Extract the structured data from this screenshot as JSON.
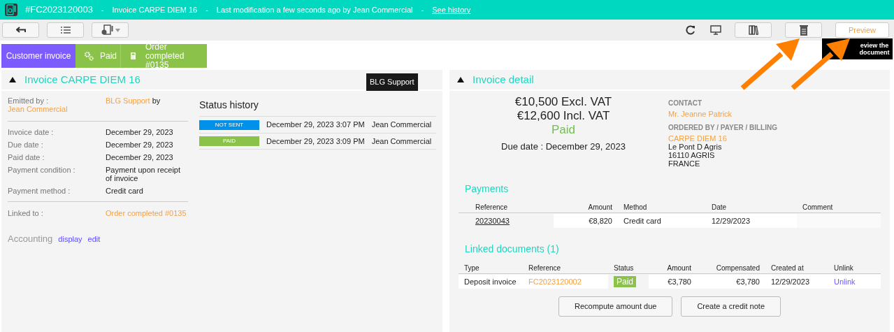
{
  "header": {
    "number": "#FC2023120003",
    "title": "Invoice CARPE DIEM 16",
    "modified": "Last modification a few seconds ago by Jean Commercial",
    "history_link": "See history",
    "separator": "-"
  },
  "toolbar": {
    "preview": "Preview",
    "tooltip": "eview the document"
  },
  "status_steps": [
    {
      "label": "Customer invoice",
      "kind": "type"
    },
    {
      "label": "Paid",
      "kind": "status"
    },
    {
      "label": "Order completed #0135",
      "kind": "order"
    }
  ],
  "invoice_panel": {
    "title": "Invoice CARPE DIEM 16",
    "expanded": true,
    "badge": "BLG Support",
    "emitted_label": "Emitted by :",
    "emitted_company": "BLG Support",
    "emitted_by": "by",
    "emitted_person": "Jean Commercial",
    "fields": [
      {
        "label": "Invoice date :",
        "value": "December 29, 2023"
      },
      {
        "label": "Due date :",
        "value": "December 29, 2023"
      },
      {
        "label": "Paid date :",
        "value": "December 29, 2023"
      },
      {
        "label": "Payment condition :",
        "value": "Payment upon receipt of invoice"
      },
      {
        "label": "Payment method :",
        "value": "Credit card"
      }
    ],
    "linked_label": "Linked to :",
    "linked_value": "Order completed #0135",
    "accounting": "Accounting",
    "accounting_links": [
      "display",
      "edit"
    ],
    "status_history_title": "Status history",
    "status_history": [
      {
        "status": "NOT SENT",
        "color": "#0091ea",
        "date": "December 29, 2023 3:07 PM",
        "user": "Jean Commercial"
      },
      {
        "status": "PAID",
        "color": "#8bc34a",
        "date": "December 29, 2023 3:09 PM",
        "user": "Jean Commercial"
      }
    ]
  },
  "detail_panel": {
    "title": "Invoice detail",
    "expanded": true,
    "excl_vat": "€10,500 Excl. VAT",
    "incl_vat": "€12,600 Incl. VAT",
    "status": "Paid",
    "due": "Due date : December 29, 2023",
    "contact_label": "CONTACT",
    "contact": "Mr. Jeanne Patrick",
    "billing_label": "ORDERED BY / PAYER / BILLING",
    "billing_name": "CARPE DIEM 16",
    "address": [
      "Le Pont D Agris",
      "16110 AGRIS",
      "FRANCE"
    ],
    "payments_title": "Payments",
    "payments_columns": [
      "Reference",
      "Amount",
      "Method",
      "Date",
      "Comment"
    ],
    "payments": [
      {
        "reference": "20230043",
        "amount": "€8,820",
        "method": "Credit card",
        "date": "12/29/2023"
      }
    ],
    "linked_title": "Linked documents (1)",
    "linked_columns": [
      "Type",
      "Reference",
      "Status",
      "Amount",
      "Compensated",
      "Created at",
      "Unlink"
    ],
    "linked": [
      {
        "type": "Deposit invoice",
        "reference": "FC2023120002",
        "status": "Paid",
        "amount": "€3,780",
        "compensated": "€3,780",
        "created": "12/29/2023",
        "unlink": "Unlink"
      }
    ],
    "buttons": [
      "Recompute amount due",
      "Create a credit note"
    ]
  }
}
